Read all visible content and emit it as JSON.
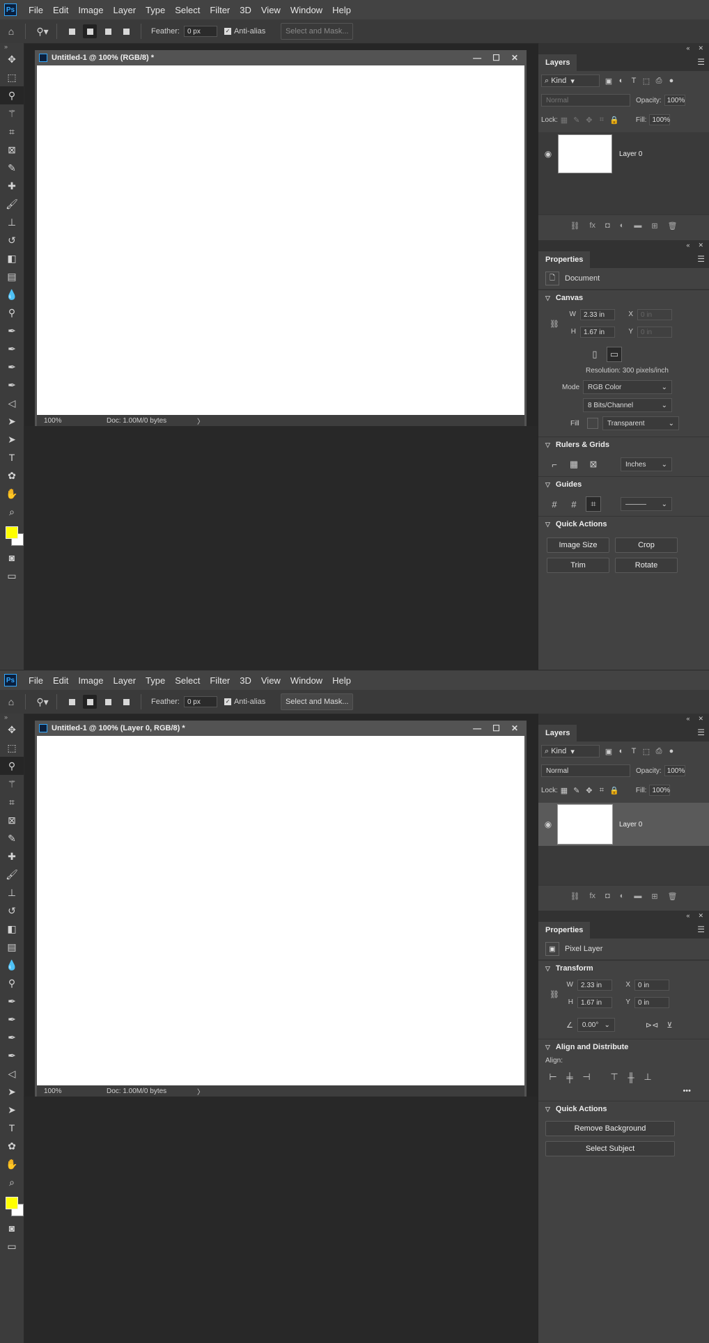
{
  "menu": [
    "File",
    "Edit",
    "Image",
    "Layer",
    "Type",
    "Select",
    "Filter",
    "3D",
    "View",
    "Window",
    "Help"
  ],
  "logo": "Ps",
  "options": {
    "feather_label": "Feather:",
    "feather_value": "0 px",
    "antialias_label": "Anti-alias",
    "select_mask": "Select and Mask..."
  },
  "top": {
    "doc_title": "Untitled-1 @ 100% (RGB/8) *",
    "zoom": "100%",
    "doc_info": "Doc: 1.00M/0 bytes",
    "status_arrow": "〉"
  },
  "bottom": {
    "doc_title": "Untitled-1 @ 100% (Layer 0, RGB/8) *",
    "zoom": "100%",
    "doc_info": "Doc: 1.00M/0 bytes",
    "status_arrow": "〉"
  },
  "layers": {
    "tab": "Layers",
    "kind": "Kind",
    "blend": "Normal",
    "opacity_label": "Opacity:",
    "opacity_value": "100%",
    "lock_label": "Lock:",
    "fill_label": "Fill:",
    "fill_value": "100%",
    "layer_name": "Layer 0"
  },
  "props_top": {
    "tab": "Properties",
    "type": "Document",
    "canvas_head": "Canvas",
    "w_label": "W",
    "w": "2.33 in",
    "h_label": "H",
    "h": "1.67 in",
    "x_label": "X",
    "x": "0 in",
    "y_label": "Y",
    "y": "0 in",
    "resolution": "Resolution: 300 pixels/inch",
    "mode_label": "Mode",
    "mode": "RGB Color",
    "bits": "8 Bits/Channel",
    "fill_label": "Fill",
    "fill": "Transparent",
    "rulers_head": "Rulers & Grids",
    "units": "Inches",
    "guides_head": "Guides",
    "qa_head": "Quick Actions",
    "qa": [
      "Image Size",
      "Crop",
      "Trim",
      "Rotate"
    ]
  },
  "props_bottom": {
    "tab": "Properties",
    "type": "Pixel Layer",
    "transform_head": "Transform",
    "w_label": "W",
    "w": "2.33 in",
    "h_label": "H",
    "h": "1.67 in",
    "x_label": "X",
    "x": "0 in",
    "y_label": "Y",
    "y": "0 in",
    "angle": "0.00°",
    "align_head": "Align and Distribute",
    "align_label": "Align:",
    "more": "•••",
    "qa_head": "Quick Actions",
    "qa": [
      "Remove Background",
      "Select Subject"
    ]
  },
  "colors": {
    "foreground": "#ffff00",
    "background": "#ffffff",
    "accent": "#31a8ff"
  },
  "tools": [
    "move-tool",
    "marquee-tool",
    "lasso-tool",
    "magic-wand-tool",
    "crop-tool",
    "frame-tool",
    "eyedropper-tool",
    "healing-brush-tool",
    "brush-tool",
    "clone-stamp-tool",
    "history-brush-tool",
    "eraser-tool",
    "gradient-tool",
    "blur-tool",
    "dodge-tool",
    "pen-tool",
    "freeform-pen-tool",
    "curvature-pen-tool",
    "path-select-tool",
    "direct-select-tool",
    "arrow-tool",
    "type-tool",
    "custom-shape-tool",
    "hand-tool",
    "zoom-tool"
  ]
}
